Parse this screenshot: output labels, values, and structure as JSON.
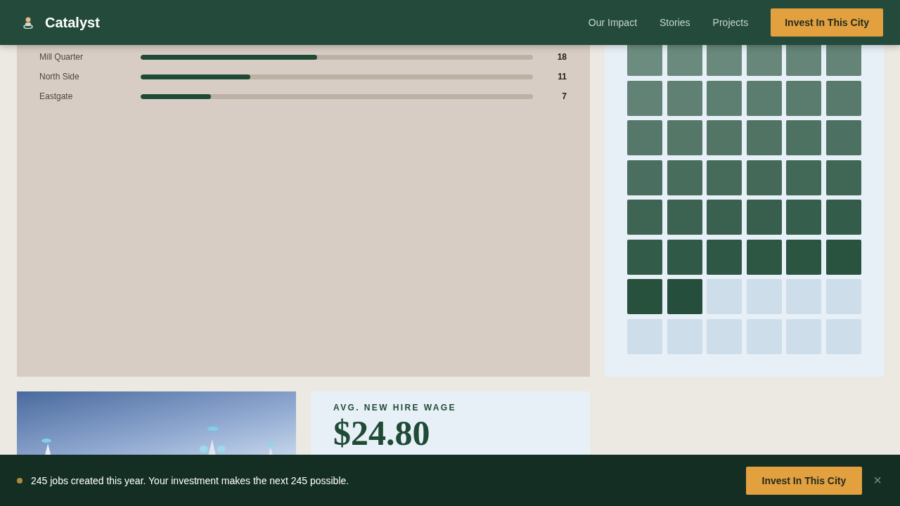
{
  "header": {
    "brand": "Catalyst",
    "nav": [
      "Our Impact",
      "Stories",
      "Projects"
    ],
    "cta": "Invest In This City"
  },
  "districts": [
    {
      "name": "Mill Quarter",
      "level": 0.45,
      "count": "18"
    },
    {
      "name": "North Side",
      "level": 0.28,
      "count": "11"
    },
    {
      "name": "Eastgate",
      "level": 0.18,
      "count": "7"
    }
  ],
  "job_grid": {
    "cells": [
      {
        "filled": true
      },
      {
        "filled": true
      },
      {
        "filled": true
      },
      {
        "filled": true
      },
      {
        "filled": true
      },
      {
        "filled": true
      },
      {
        "filled": true
      },
      {
        "filled": true
      },
      {
        "filled": true
      },
      {
        "filled": true
      },
      {
        "filled": true
      },
      {
        "filled": true
      },
      {
        "filled": true
      },
      {
        "filled": true
      },
      {
        "filled": true
      },
      {
        "filled": true
      },
      {
        "filled": true
      },
      {
        "filled": true
      },
      {
        "filled": true
      },
      {
        "filled": true
      },
      {
        "filled": true
      },
      {
        "filled": true
      },
      {
        "filled": true
      },
      {
        "filled": true
      },
      {
        "filled": true
      },
      {
        "filled": true
      },
      {
        "filled": true
      },
      {
        "filled": true
      },
      {
        "filled": true
      },
      {
        "filled": true
      },
      {
        "filled": true
      },
      {
        "filled": true
      },
      {
        "filled": true
      },
      {
        "filled": true
      },
      {
        "filled": true
      },
      {
        "filled": true
      },
      {
        "filled": true
      },
      {
        "filled": true
      },
      {
        "filled": false
      },
      {
        "filled": false
      },
      {
        "filled": false
      },
      {
        "filled": false
      },
      {
        "filled": false
      },
      {
        "filled": false
      },
      {
        "filled": false
      },
      {
        "filled": false
      },
      {
        "filled": false
      },
      {
        "filled": false
      }
    ]
  },
  "wage_card": {
    "label": "AVG. NEW HIRE WAGE",
    "value": "$24.80"
  },
  "banner": {
    "message": "245 jobs created this year. Your investment makes the next 245 possible.",
    "cta": "Invest In This City",
    "close": "×"
  }
}
